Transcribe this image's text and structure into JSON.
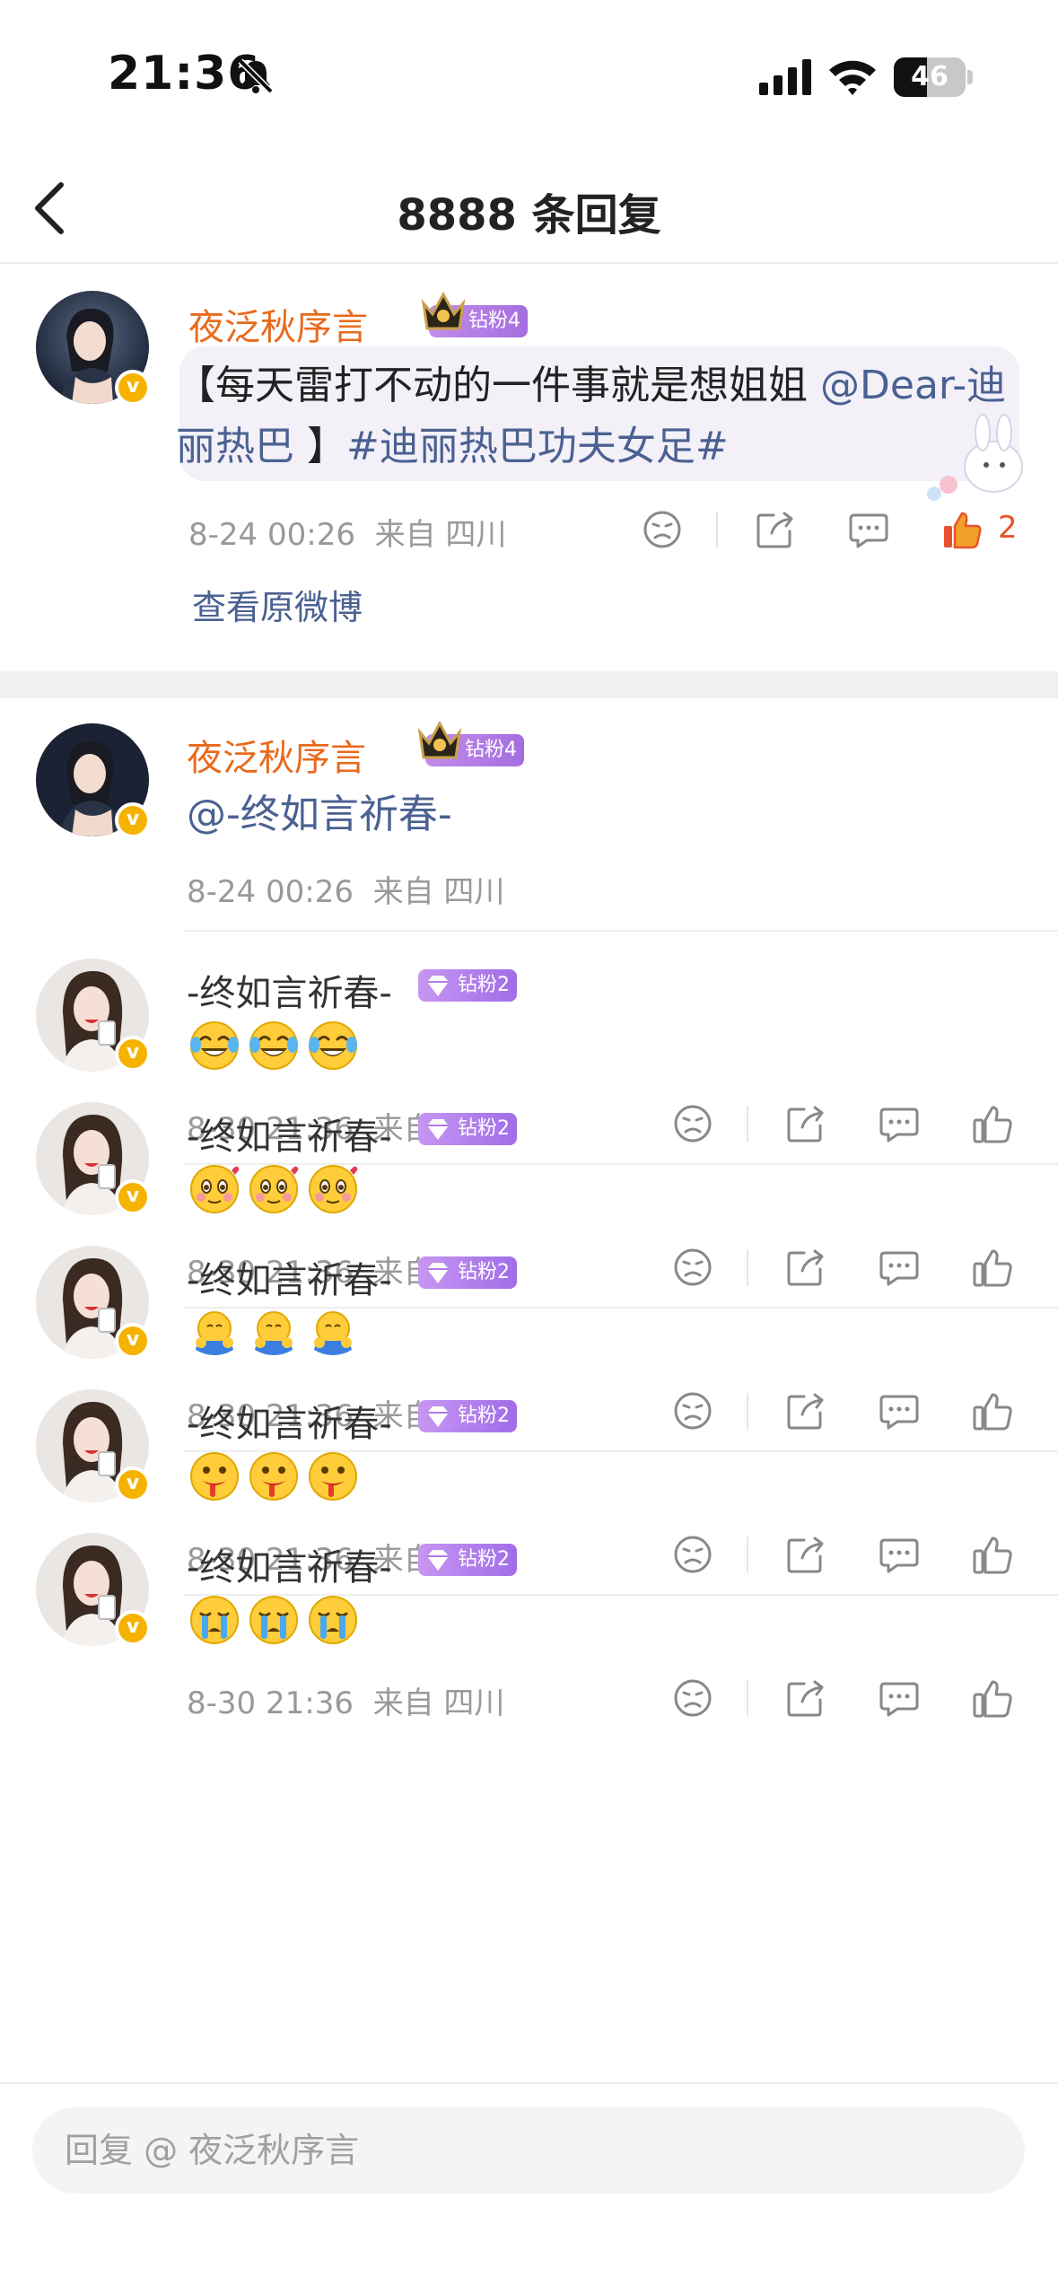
{
  "status_bar": {
    "time": "21:36",
    "battery": "46",
    "battery_level": 0.46
  },
  "nav": {
    "title": "8888 条回复"
  },
  "main_post": {
    "username": "夜泛秋序言",
    "fan_badge": "钻粉4",
    "text_plain_1": "【每天雷打不动的一件事就是想姐姐 ",
    "mention": "@Dear-迪丽热巴",
    "text_plain_2": " 】",
    "hashtag": "#迪丽热巴功夫女足#",
    "time": "8-24 00:26",
    "location": "来自 四川",
    "like_count": "2",
    "view_original": "查看原微博"
  },
  "replies": [
    {
      "username": "夜泛秋序言",
      "fan_badge": "钻粉4",
      "text": "@-终如言祈春-",
      "time": "8-24 00:26",
      "location": "来自 四川"
    },
    {
      "username": "-终如言祈春-",
      "fan_badge": "钻粉2",
      "emoji": "laugh-cry",
      "time": "8-30 21:36",
      "location": "来自 四川"
    },
    {
      "username": "-终如言祈春-",
      "fan_badge": "钻粉2",
      "emoji": "heart-blush",
      "time": "8-30 21:36",
      "location": "来自 四川"
    },
    {
      "username": "-终如言祈春-",
      "fan_badge": "钻粉2",
      "emoji": "hug",
      "time": "8-30 21:36",
      "location": "来自 四川"
    },
    {
      "username": "-终如言祈春-",
      "fan_badge": "钻粉2",
      "emoji": "drool",
      "time": "8-30 21:36",
      "location": "来自 四川"
    },
    {
      "username": "-终如言祈春-",
      "fan_badge": "钻粉2",
      "emoji": "crying",
      "time": "8-30 21:36",
      "location": "来自 四川"
    }
  ],
  "reply_bar": {
    "placeholder": "回复 @ 夜泛秋序言"
  },
  "colors": {
    "username_orange": "#e86a1c",
    "link_blue": "#4a6191",
    "like_red": "#e8522c"
  }
}
